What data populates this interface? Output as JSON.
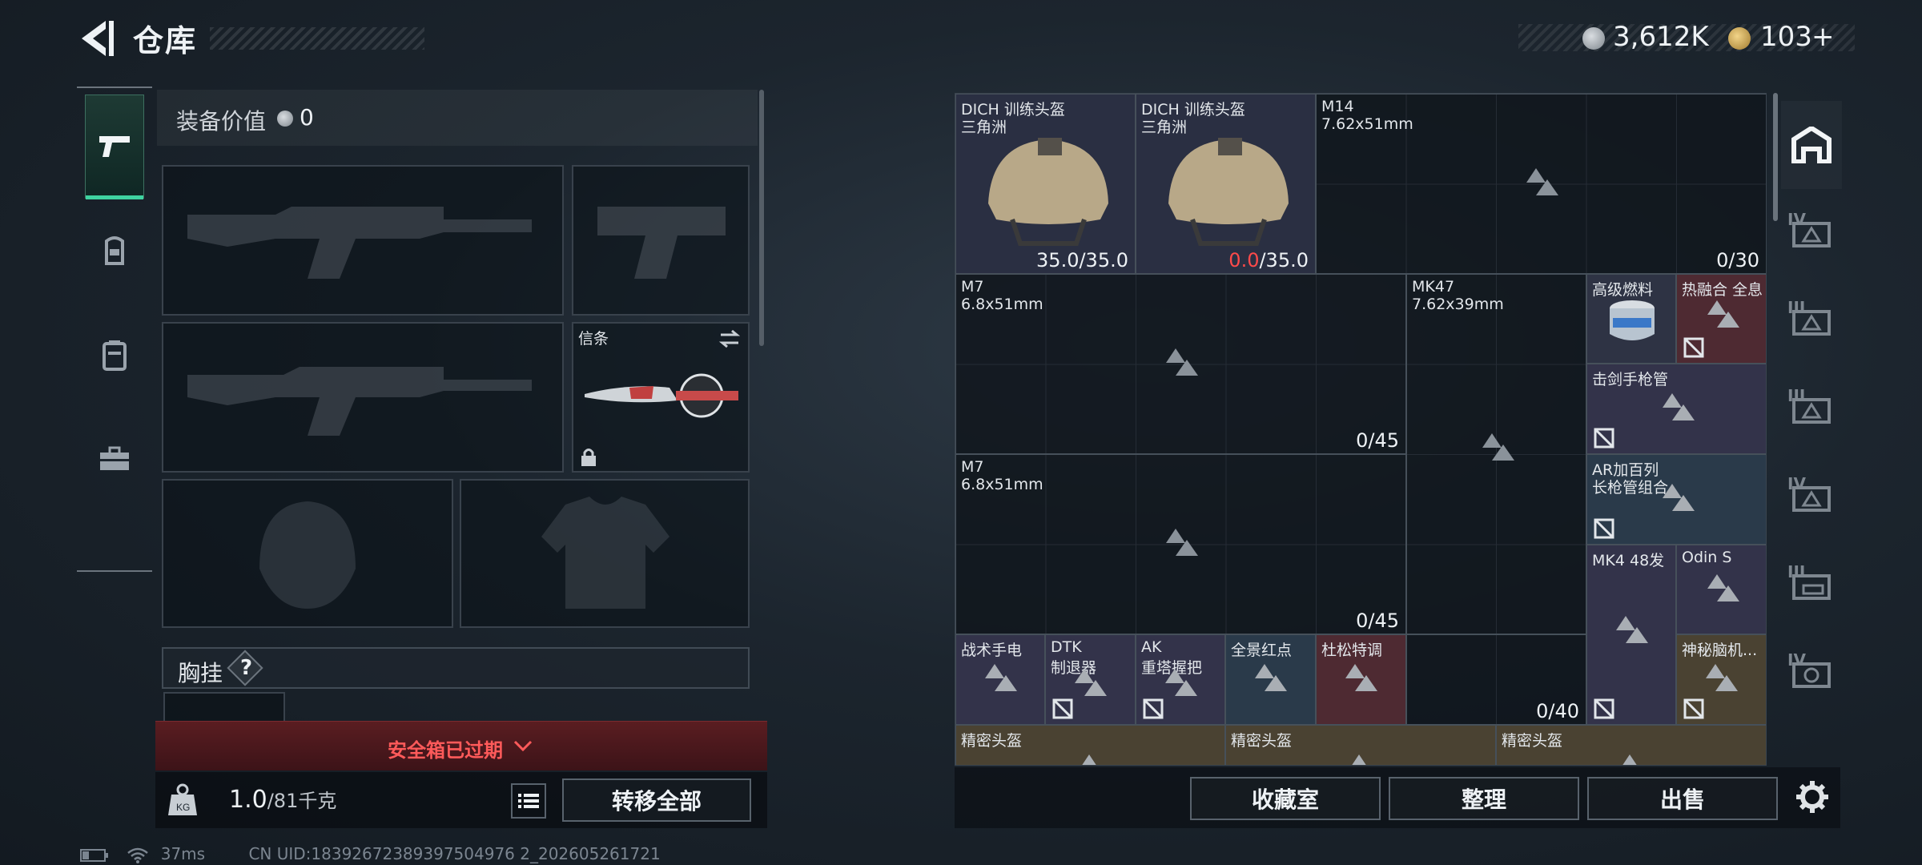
{
  "header": {
    "title": "仓库"
  },
  "currency": {
    "coins": "3,612K",
    "tokens": "103",
    "plus": "+"
  },
  "equip": {
    "label": "装备价值",
    "value": "0"
  },
  "slots": {
    "knife_label": "信条"
  },
  "chest": {
    "label": "胸挂",
    "question": "?"
  },
  "safebox": {
    "text": "安全箱已过期"
  },
  "weight": {
    "current": "1.0",
    "max": "/81千克",
    "kg_icon": "KG"
  },
  "buttons": {
    "transfer_all": "转移全部",
    "collection": "收藏室",
    "sort": "整理",
    "sell": "出售"
  },
  "grid_items": [
    {
      "name1": "DICH 训练头盔",
      "name2": "三角洲",
      "durability_cur": "35.0",
      "durability_max": "/35.0"
    },
    {
      "name1": "DICH 训练头盔",
      "name2": "三角洲",
      "durability_cur": "0.0",
      "durability_max": "/35.0"
    },
    {
      "name1": "M14",
      "name2": "7.62x51mm",
      "count": "0/30"
    },
    {
      "name1": "M7",
      "name2": "6.8x51mm",
      "count": "0/45"
    },
    {
      "name1": "MK47",
      "name2": "7.62x39mm"
    },
    {
      "name1": "高级燃料"
    },
    {
      "name1": "热融合 全息"
    },
    {
      "name1": "击剑手枪管"
    },
    {
      "name1": "M7",
      "name2": "6.8x51mm",
      "count": "0/45"
    },
    {
      "name1": "AR加百列",
      "name2": "长枪管组合"
    },
    {
      "name1": "MK4 48发"
    },
    {
      "name1": "Odin S"
    },
    {
      "name1": "战术手电"
    },
    {
      "name1": "DTK",
      "name2": "制退器"
    },
    {
      "name1": "AK",
      "name2": "重塔握把"
    },
    {
      "name1": "全景红点"
    },
    {
      "name1": "杜松特调"
    },
    {
      "count": "0/40"
    },
    {
      "name1": "神秘脑机..."
    },
    {
      "name1": "精密头盔"
    },
    {
      "name1": "精密头盔"
    },
    {
      "name1": "精密头盔"
    }
  ],
  "right_tabs": {
    "t1": "IV",
    "t2": "III",
    "t3": "III",
    "t4": "IV",
    "t5": "III",
    "t6": "IV"
  },
  "status": {
    "ping": "37ms",
    "uid": "CN UID:18392672389397504976 2_202605261721"
  },
  "colors": {
    "accent": "#3fd3a0",
    "danger": "#ff5a5a",
    "gold_rarity": "#5a4a2e",
    "red_rarity": "#5a2a30",
    "blue_rarity": "#2a3a4a",
    "purple_rarity": "#33334a"
  }
}
